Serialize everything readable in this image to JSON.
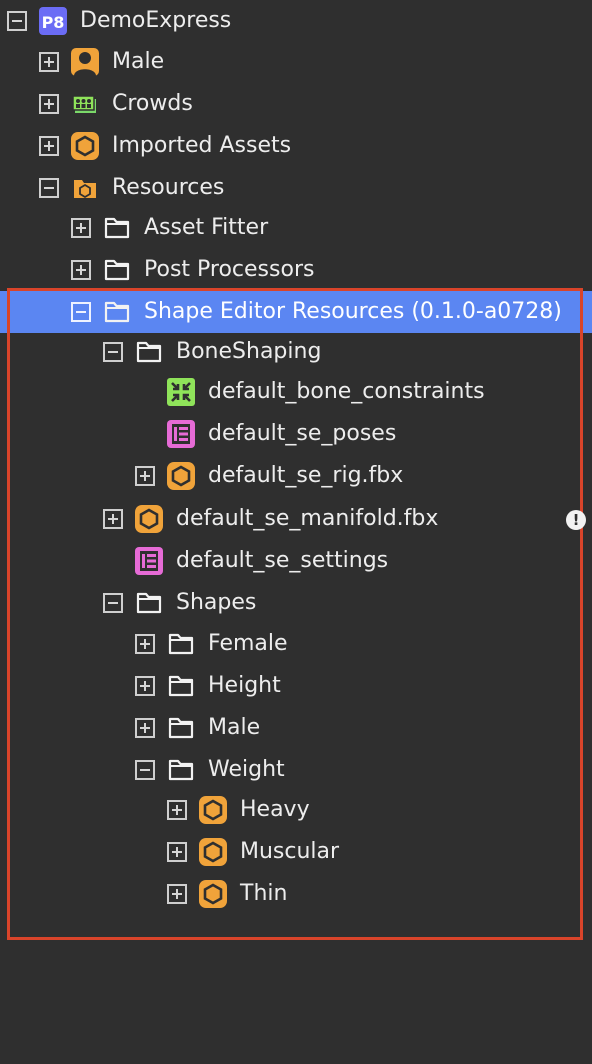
{
  "tree": {
    "rows": [
      {
        "name": "DemoExpress",
        "depth": 0,
        "toggle": "minus",
        "icon": "p8-icon",
        "label": "DemoExpress"
      },
      {
        "name": "Male",
        "depth": 1,
        "toggle": "plus",
        "icon": "person-icon",
        "label": "Male"
      },
      {
        "name": "Crowds",
        "depth": 1,
        "toggle": "plus",
        "icon": "crowd-icon",
        "label": "Crowds"
      },
      {
        "name": "Imported Assets",
        "depth": 1,
        "toggle": "plus",
        "icon": "hexagon-asset-icon",
        "label": "Imported Assets"
      },
      {
        "name": "Resources",
        "depth": 1,
        "toggle": "minus",
        "icon": "resources-folder-icon",
        "label": "Resources"
      },
      {
        "name": "Asset Fitter",
        "depth": 2,
        "toggle": "plus",
        "icon": "folder-icon",
        "label": "Asset Fitter"
      },
      {
        "name": "Post Processors",
        "depth": 2,
        "toggle": "plus",
        "icon": "folder-icon",
        "label": "Post Processors"
      },
      {
        "name": "Shape Editor Resources",
        "depth": 2,
        "toggle": "minus",
        "icon": "folder-icon",
        "label": "Shape Editor Resources (0.1.0-a0728)",
        "selected": true
      },
      {
        "name": "BoneShaping",
        "depth": 3,
        "toggle": "minus",
        "icon": "folder-icon",
        "label": "BoneShaping"
      },
      {
        "name": "default_bone_constraints",
        "depth": 4,
        "toggle": "none",
        "icon": "constraints-icon",
        "label": "default_bone_constraints"
      },
      {
        "name": "default_se_poses",
        "depth": 4,
        "toggle": "none",
        "icon": "settings-doc-icon",
        "label": "default_se_poses"
      },
      {
        "name": "default_se_rig.fbx",
        "depth": 4,
        "toggle": "plus",
        "icon": "hexagon-asset-icon",
        "label": "default_se_rig.fbx"
      },
      {
        "name": "default_se_manifold.fbx",
        "depth": 3,
        "toggle": "plus",
        "icon": "hexagon-asset-icon",
        "label": "default_se_manifold.fbx",
        "warning": true
      },
      {
        "name": "default_se_settings",
        "depth": 3,
        "toggle": "none",
        "icon": "settings-doc-icon",
        "label": "default_se_settings"
      },
      {
        "name": "Shapes",
        "depth": 3,
        "toggle": "minus",
        "icon": "folder-icon",
        "label": "Shapes"
      },
      {
        "name": "Female",
        "depth": 4,
        "toggle": "plus",
        "icon": "folder-icon",
        "label": "Female"
      },
      {
        "name": "Height",
        "depth": 4,
        "toggle": "plus",
        "icon": "folder-icon",
        "label": "Height"
      },
      {
        "name": "Male",
        "depth": 4,
        "toggle": "plus",
        "icon": "folder-icon",
        "label": "Male"
      },
      {
        "name": "Weight",
        "depth": 4,
        "toggle": "minus",
        "icon": "folder-icon",
        "label": "Weight"
      },
      {
        "name": "Heavy",
        "depth": 5,
        "toggle": "plus",
        "icon": "hexagon-asset-icon",
        "label": "Heavy"
      },
      {
        "name": "Muscular",
        "depth": 5,
        "toggle": "plus",
        "icon": "hexagon-asset-icon",
        "label": "Muscular"
      },
      {
        "name": "Thin",
        "depth": 5,
        "toggle": "plus",
        "icon": "hexagon-asset-icon",
        "label": "Thin"
      }
    ]
  },
  "warning_text": "!",
  "colors": {
    "background": "#2f2f2f",
    "selection": "#5b86f2",
    "highlight_box": "#d9442a",
    "asset_orange": "#f0a33a",
    "p8_badge": "#6b6cf5",
    "constraints_green": "#8fe35a",
    "settings_magenta": "#e66bd6"
  }
}
